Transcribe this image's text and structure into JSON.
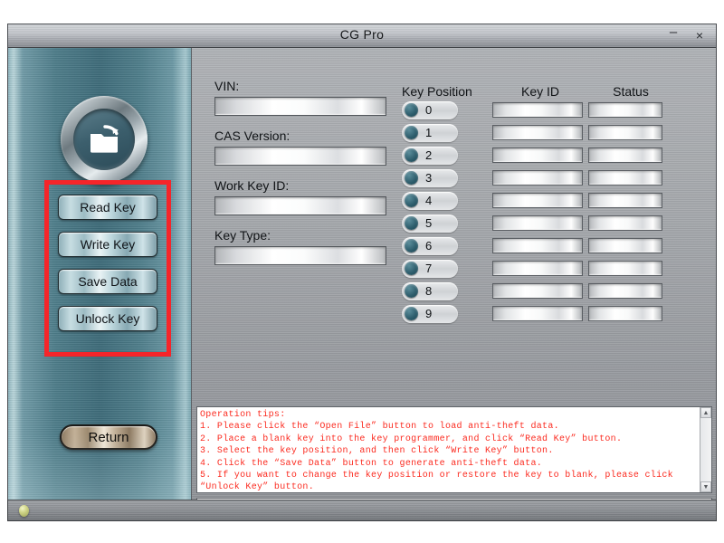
{
  "window": {
    "title": "CG Pro",
    "minimize_label": "–",
    "close_label": "×"
  },
  "sidebar": {
    "open_file_icon": "open-folder-icon",
    "buttons": [
      {
        "label": "Read Key"
      },
      {
        "label": "Write Key"
      },
      {
        "label": "Save Data"
      },
      {
        "label": "Unlock Key"
      }
    ],
    "return_label": "Return",
    "highlight_color": "#f5252a"
  },
  "form": {
    "fields": [
      {
        "label": "VIN:",
        "value": "",
        "placeholder": ""
      },
      {
        "label": "CAS Version:",
        "value": "",
        "placeholder": ""
      },
      {
        "label": "Work Key ID:",
        "value": "",
        "placeholder": ""
      },
      {
        "label": "Key Type:",
        "value": "",
        "placeholder": ""
      }
    ]
  },
  "key_table": {
    "headers": {
      "position": "Key Position",
      "key_id": "Key ID",
      "status": "Status"
    },
    "rows": [
      {
        "position": "0",
        "key_id": "",
        "status": ""
      },
      {
        "position": "1",
        "key_id": "",
        "status": ""
      },
      {
        "position": "2",
        "key_id": "",
        "status": ""
      },
      {
        "position": "3",
        "key_id": "",
        "status": ""
      },
      {
        "position": "4",
        "key_id": "",
        "status": ""
      },
      {
        "position": "5",
        "key_id": "",
        "status": ""
      },
      {
        "position": "6",
        "key_id": "",
        "status": ""
      },
      {
        "position": "7",
        "key_id": "",
        "status": ""
      },
      {
        "position": "8",
        "key_id": "",
        "status": ""
      },
      {
        "position": "9",
        "key_id": "",
        "status": ""
      }
    ]
  },
  "tips": {
    "text": "Operation tips:\n1. Please click the “Open File” button to load anti-theft data.\n2. Place a blank key into the key programmer, and click “Read Key” button.\n3. Select the key position, and then click “Write Key” button.\n4. Click the “Save Data” button to generate anti-theft data.\n5. If you want to change the key position or restore the key to blank, please click “Unlock Key” button.",
    "text_color": "#fb2b20",
    "scroll_up_icon": "▲",
    "scroll_down_icon": "▼"
  },
  "bottom_input": {
    "value": "",
    "placeholder": ""
  },
  "statusbar": {
    "led": "status-led-indicator",
    "text": ""
  }
}
